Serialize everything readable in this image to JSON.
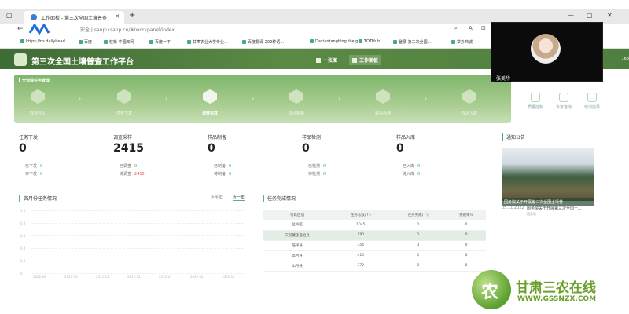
{
  "browser": {
    "tab_title": "工作面板 - 第三次全国土壤普查",
    "address": "安全 | sanpu.sanp.cn/#/workpanel/index",
    "bookmarks": [
      "https://ns.dailyhead...",
      "百度",
      "粒新 中国知网",
      "百度一下",
      "甘肃农业大学专业...",
      "百度翻译-200种语...",
      "Daxiantanghing the g...",
      "TOTHub",
      "登录 第三次全国...",
      "举办商城"
    ]
  },
  "site": {
    "title": "第三次全国土壤普查工作平台",
    "nav": [
      "一张图",
      "工作面板"
    ],
    "right_text": "168"
  },
  "banner": {
    "title": "全流程任务管理",
    "steps": [
      "样点导入",
      "任务下发",
      "调查采样",
      "样品制备",
      "样品检测",
      "样品入库"
    ]
  },
  "side_icons": [
    "质量控制",
    "专家咨询",
    "培训指导"
  ],
  "stats": [
    {
      "title": "任务下发",
      "value": "0",
      "sub": [
        {
          "label": "已下发",
          "n": "0"
        },
        {
          "label": "待下发",
          "n": "0"
        }
      ]
    },
    {
      "title": "调查采样",
      "value": "2415",
      "sub": [
        {
          "label": "已调查",
          "n": "0"
        },
        {
          "label": "待调查",
          "n": "2415"
        }
      ]
    },
    {
      "title": "样品制备",
      "value": "0",
      "sub": [
        {
          "label": "已制备",
          "n": "0"
        },
        {
          "label": "待制备",
          "n": "0"
        }
      ]
    },
    {
      "title": "样品检测",
      "value": "0",
      "sub": [
        {
          "label": "已检测",
          "n": "0"
        },
        {
          "label": "待检测",
          "n": "0"
        }
      ]
    },
    {
      "title": "样品入库",
      "value": "0",
      "sub": [
        {
          "label": "已入库",
          "n": "0"
        },
        {
          "label": "待入库",
          "n": "0"
        }
      ]
    }
  ],
  "news": {
    "title": "通知公告",
    "caption": "国务院关于开展第三次全国土壤普...",
    "date": "05.11 2022",
    "headline": "国务院关于开展第三次全国土...",
    "source": "国家局"
  },
  "monthly": {
    "title": "各月份任务情况",
    "toggles": [
      "近半年",
      "近一年"
    ],
    "y_ticks": [
      "1.0",
      "0.8",
      "0.6",
      "0.4",
      "0.2",
      "0"
    ],
    "x_ticks": [
      "2021-09",
      "2021-10",
      "2021-11",
      "2021-12",
      "2022-01",
      "2022-02",
      "2022-03"
    ]
  },
  "completion": {
    "title": "任务完成情况",
    "headers": [
      "行政区划",
      "任务总数(个)",
      "任务完成(个)",
      "完成率%"
    ],
    "rows": [
      [
        "兰州区",
        "1045",
        "0",
        "0"
      ],
      [
        "天祝藏族自治县",
        "180",
        "0",
        "0"
      ],
      [
        "临泽县",
        "354",
        "0",
        "0"
      ],
      [
        "高台县",
        "415",
        "0",
        "0"
      ],
      [
        "山丹县",
        "372",
        "0",
        "0"
      ]
    ]
  },
  "video": {
    "name": "张美华"
  },
  "watermark": {
    "char": "农",
    "brand": "甘肃三农在线",
    "url": "WWW.GSSNZX.COM"
  }
}
